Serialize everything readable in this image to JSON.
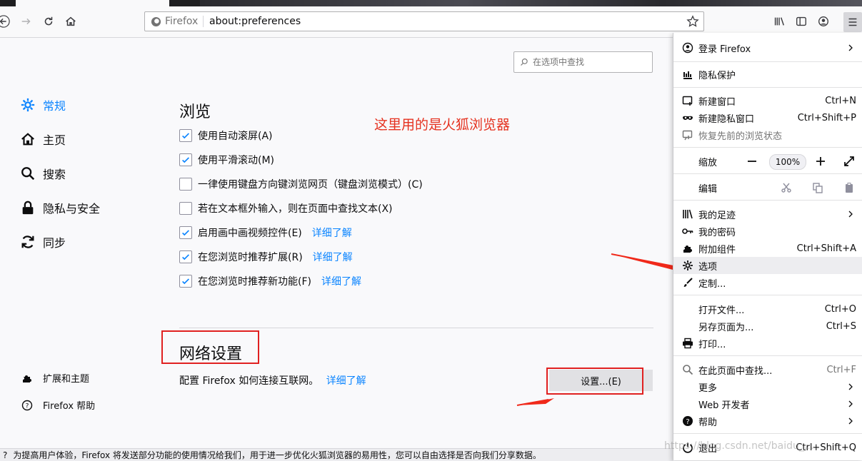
{
  "toolbar": {
    "identity_label": "Firefox",
    "url": "about:preferences"
  },
  "search": {
    "placeholder": "在选项中查找"
  },
  "sidebar": {
    "categories": [
      {
        "label": "常规",
        "icon": "gear-icon",
        "selected": true
      },
      {
        "label": "主页",
        "icon": "home-icon"
      },
      {
        "label": "搜索",
        "icon": "search-icon"
      },
      {
        "label": "隐私与安全",
        "icon": "lock-icon"
      },
      {
        "label": "同步",
        "icon": "sync-icon"
      }
    ],
    "footer": [
      {
        "label": "扩展和主题",
        "icon": "puzzle-icon"
      },
      {
        "label": "Firefox 帮助",
        "icon": "help-icon"
      }
    ]
  },
  "browsing": {
    "heading": "浏览",
    "options": [
      {
        "label": "使用自动滚屏(A)",
        "checked": true
      },
      {
        "label": "使用平滑滚动(M)",
        "checked": true
      },
      {
        "label": "一律使用键盘方向键浏览网页（键盘浏览模式）(C)",
        "checked": false
      },
      {
        "label": "若在文本框外输入，则在页面中查找文本(X)",
        "checked": false
      },
      {
        "label": "启用画中画视频控件(E)",
        "checked": true,
        "link": "详细了解"
      },
      {
        "label": "在您浏览时推荐扩展(R)",
        "checked": true,
        "link": "详细了解"
      },
      {
        "label": "在您浏览时推荐新功能(F)",
        "checked": true,
        "link": "详细了解"
      }
    ]
  },
  "annotation": "这里用的是火狐浏览器",
  "network": {
    "heading": "网络设置",
    "description": "配置 Firefox 如何连接互联网。",
    "link": "详细了解",
    "button": "设置...(E)"
  },
  "infobar": "为提高用户体验，Firefox 将发送部分功能的使用情况给我们，用于进一步优化火狐浏览器的易用性，您可以自由选择是否向我们分享数据。",
  "appmenu": {
    "signin": "登录 Firefox",
    "privacy": "隐私保护",
    "new_window": "新建窗口",
    "new_window_sc": "Ctrl+N",
    "new_private": "新建隐私窗口",
    "new_private_sc": "Ctrl+Shift+P",
    "restore": "恢复先前的浏览状态",
    "zoom": "缩放",
    "zoom_value": "100%",
    "edit": "编辑",
    "library": "我的足迹",
    "logins": "我的密码",
    "addons": "附加组件",
    "addons_sc": "Ctrl+Shift+A",
    "options": "选项",
    "customize": "定制...",
    "open_file": "打开文件...",
    "open_file_sc": "Ctrl+O",
    "save_as": "另存页面为...",
    "save_as_sc": "Ctrl+S",
    "print": "打印...",
    "find": "在此页面中查找...",
    "find_sc": "Ctrl+F",
    "more": "更多",
    "webdev": "Web 开发者",
    "help": "帮助",
    "quit": "退出",
    "quit_sc": "Ctrl+Shift+Q"
  },
  "watermark": "https://blog.csdn.net/baidu_..."
}
